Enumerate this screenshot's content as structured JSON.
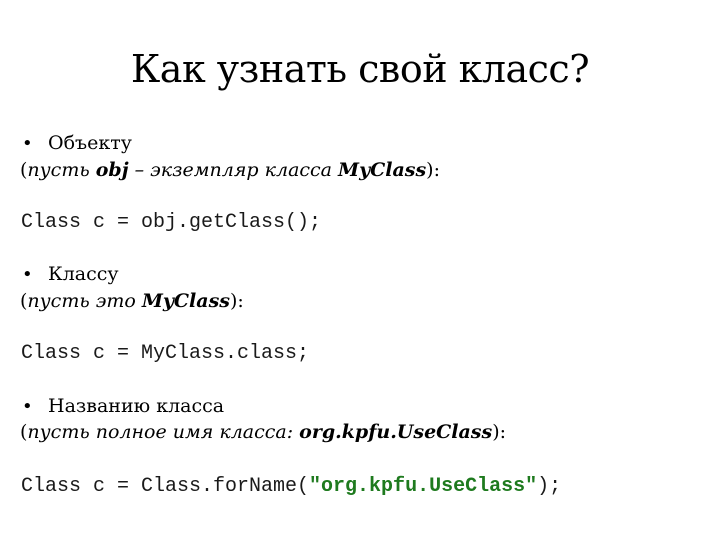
{
  "slide": {
    "title": "Как узнать свой класс?",
    "sections": [
      {
        "bullet": "Объекту",
        "note_open": "(",
        "note_parts": [
          {
            "style": "italic",
            "text": "пусть "
          },
          {
            "style": "bold-italic",
            "text": "obj"
          },
          {
            "style": "italic",
            "text": " – экземпляр класса "
          },
          {
            "style": "bold-italic",
            "text": "MyClass"
          }
        ],
        "note_close": "):",
        "code": "Class c = obj.getClass();"
      },
      {
        "bullet": "Классу",
        "note_open": "(",
        "note_parts": [
          {
            "style": "italic",
            "text": "пусть это "
          },
          {
            "style": "bold-italic",
            "text": "MyClass"
          }
        ],
        "note_close": "):",
        "code": "Class c = MyClass.class;"
      },
      {
        "bullet": "Названию класса",
        "note_open": "(",
        "note_parts": [
          {
            "style": "italic",
            "text": "пусть полное имя класса: "
          },
          {
            "style": "bold-italic",
            "text": "org.kpfu.UseClass"
          }
        ],
        "note_close": "):",
        "code_prefix": "Class c = Class.forName(",
        "code_string": "\"org.kpfu.UseClass\"",
        "code_suffix": ");"
      }
    ],
    "bullet_symbol": "•"
  },
  "colors": {
    "background": "#ffffff",
    "text": "#000000",
    "code_string": "#1e7a1e"
  }
}
